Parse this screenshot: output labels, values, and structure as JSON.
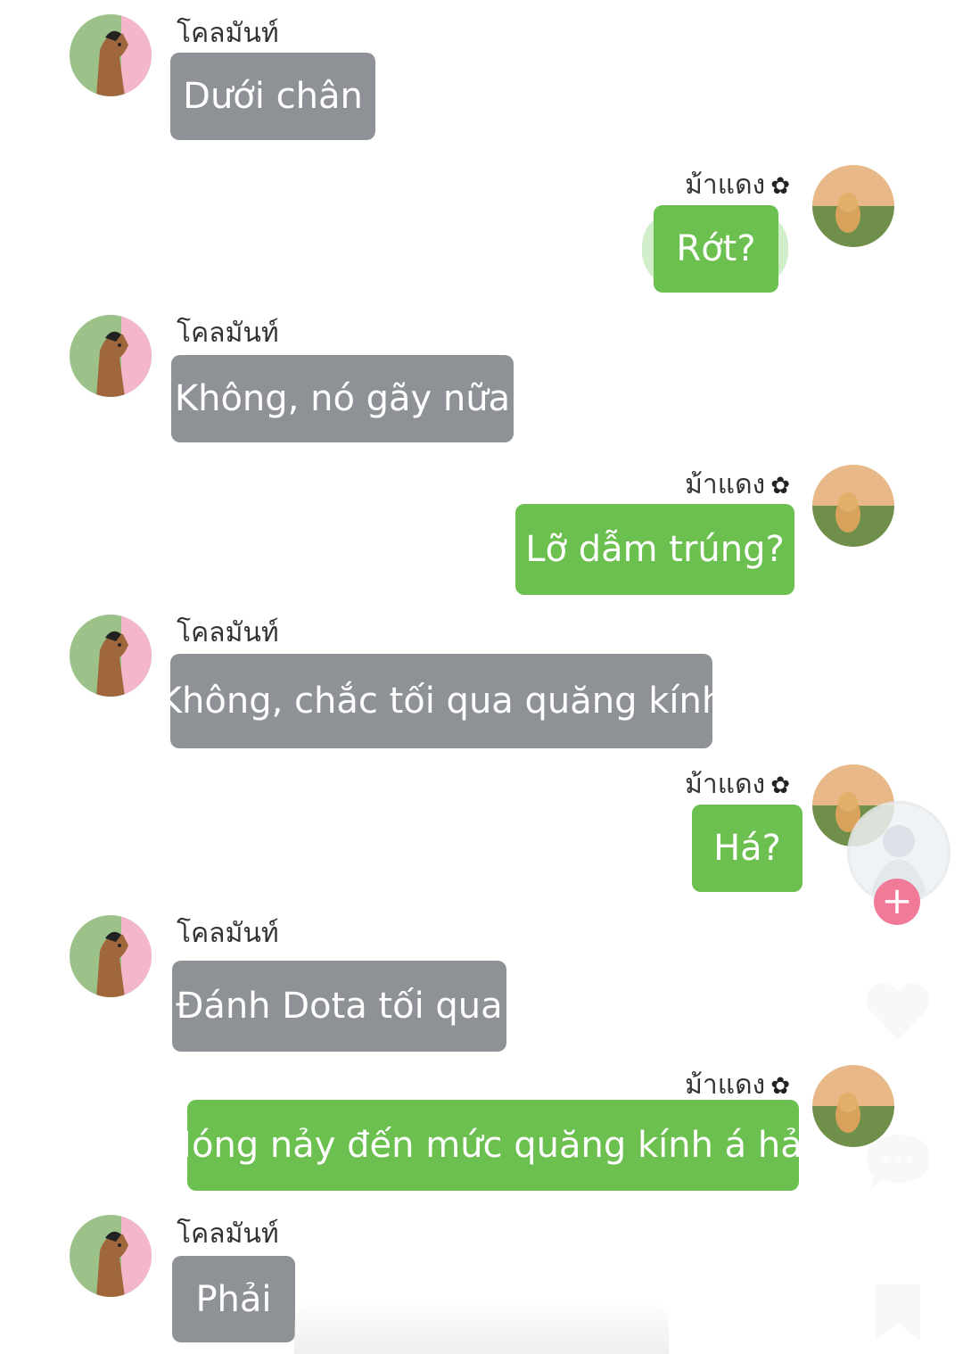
{
  "messages": [
    {
      "side": "in",
      "sender": "โคลมันท์",
      "text": "Dưới chân"
    },
    {
      "side": "out",
      "sender": "ม้าแดง",
      "text": "Rớt?"
    },
    {
      "side": "in",
      "sender": "โคลมันท์",
      "text": "Không, nó gãy nữa"
    },
    {
      "side": "out",
      "sender": "ม้าแดง",
      "text": "Lỡ dẫm trúng?"
    },
    {
      "side": "in",
      "sender": "โคลมันท์",
      "text": "Không, chắc tối qua quăng kính"
    },
    {
      "side": "out",
      "sender": "ม้าแดง",
      "text": "Há?"
    },
    {
      "side": "in",
      "sender": "โคลมันท์",
      "text": "Đánh Dota tối qua"
    },
    {
      "side": "out",
      "sender": "ม้าแดง",
      "text": "Nóng nảy đến mức quăng kính á hả?"
    },
    {
      "side": "in",
      "sender": "โคลมันท์",
      "text": "Phải"
    }
  ],
  "sender_badge": "✿",
  "float_button": {
    "plus": "+"
  },
  "icons": [
    "horse-avatar-icon",
    "dog-avatar-icon",
    "heart-icon",
    "comment-icon",
    "bookmark-icon"
  ],
  "colors": {
    "incoming": "#8e9196",
    "outgoing": "#6cc050",
    "accent": "#f07a97"
  }
}
